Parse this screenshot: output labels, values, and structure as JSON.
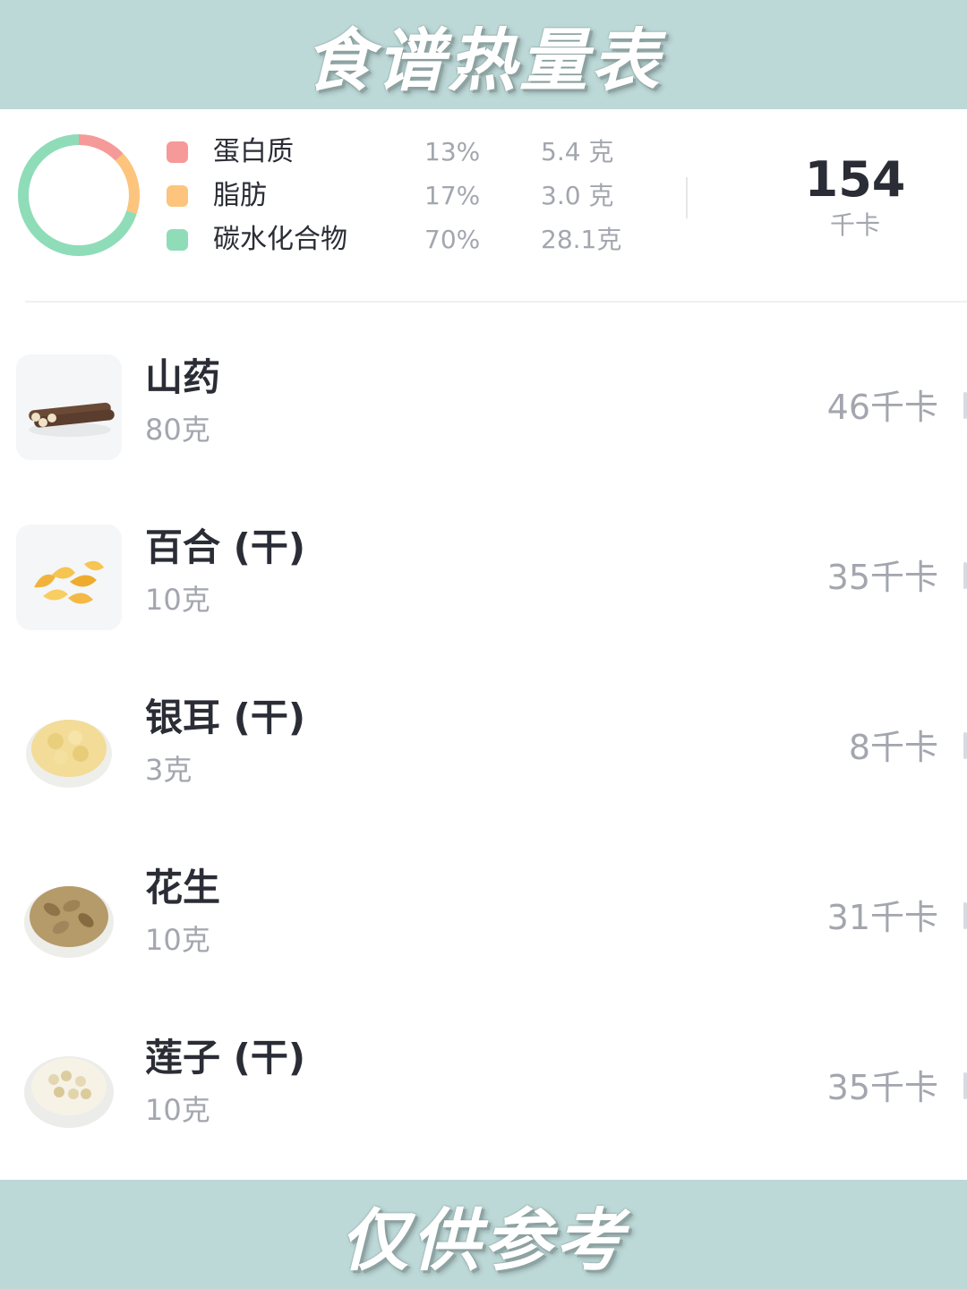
{
  "header": {
    "title": "食谱热量表"
  },
  "footer": {
    "note": "仅供参考"
  },
  "summary": {
    "macros": [
      {
        "name": "蛋白质",
        "percent": "13%",
        "grams": "5.4 克",
        "color": "#f59a98",
        "fraction": 0.13
      },
      {
        "name": "脂肪",
        "percent": "17%",
        "grams": "3.0 克",
        "color": "#fcc47c",
        "fraction": 0.17
      },
      {
        "name": "碳水化合物",
        "percent": "70%",
        "grams": "28.1克",
        "color": "#8fdcb9",
        "fraction": 0.7
      }
    ],
    "total_kcal": "154",
    "total_unit": "千卡"
  },
  "ingredients": [
    {
      "name": "山药",
      "qty": "80克",
      "kcal": "46千卡",
      "icon": "yam-icon"
    },
    {
      "name": "百合 (干)",
      "qty": "10克",
      "kcal": "35千卡",
      "icon": "dried-lily-icon"
    },
    {
      "name": "银耳 (干)",
      "qty": "3克",
      "kcal": "8千卡",
      "icon": "white-fungus-icon"
    },
    {
      "name": "花生",
      "qty": "10克",
      "kcal": "31千卡",
      "icon": "peanut-icon"
    },
    {
      "name": "莲子 (干)",
      "qty": "10克",
      "kcal": "35千卡",
      "icon": "lotus-seed-icon"
    }
  ]
}
